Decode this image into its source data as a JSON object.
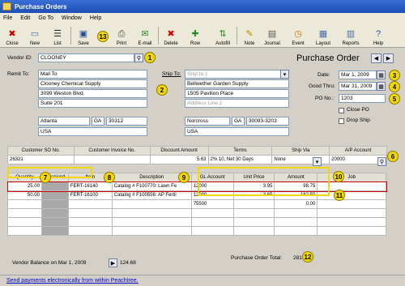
{
  "window": {
    "title": "Purchase Orders"
  },
  "menu": [
    "File",
    "Edit",
    "Go To",
    "Window",
    "Help"
  ],
  "toolbar": {
    "close": "Close",
    "new": "New",
    "list": "List",
    "save": "Save",
    "print": "Print",
    "email": "E-mail",
    "delete": "Delete",
    "row": "Row",
    "autofill": "Autofill",
    "note": "Note",
    "journal": "Journal",
    "event": "Event",
    "layout": "Layout",
    "reports": "Reports",
    "help": "Help"
  },
  "header": {
    "vendor_id_label": "Vendor ID:",
    "vendor_id": "CLOONEY",
    "form_title": "Purchase Order"
  },
  "remit": {
    "label": "Remit To:",
    "select": "Mail To",
    "lines": [
      "Clooney Chemical Supply",
      "3099 Weston Blvd.",
      "Suite 201"
    ],
    "city": "Atlanta",
    "state": "GA",
    "zip": "30312",
    "country": "USA"
  },
  "ship": {
    "label": "Ship To:",
    "select": "Ship to 1",
    "lines": [
      "Bellwether Garden Supply",
      "1505 Pavilion Place",
      "Address Line 2"
    ],
    "city": "Norcross",
    "state": "GA",
    "zip": "30093-3203",
    "country": "USA"
  },
  "dates": {
    "date_label": "Date:",
    "date": "Mar 1, 2009",
    "goodthru_label": "Good Thru:",
    "goodthru": "Mar 31, 2009",
    "po_label": "PO No.:",
    "po": "1203",
    "close_po": "Close PO",
    "drop_ship": "Drop Ship"
  },
  "terms": {
    "headers": [
      "Customer SO No.",
      "Customer Invoice No.",
      "Discount Amount",
      "Terms",
      "Ship Via",
      "A/P Account"
    ],
    "values": [
      "26321",
      "",
      "5.63",
      "2% 10, Net 30 Days",
      "None",
      "20000"
    ]
  },
  "lines": {
    "headers": [
      "Quantity",
      "Received",
      "Item",
      "Description",
      "GL Account",
      "Unit Price",
      "Amount",
      "Job"
    ],
    "rows": [
      [
        "25.00",
        "",
        "FERT-16140",
        "Catalog # F100770: Lawn Fe",
        "12000",
        "3.95",
        "98.75",
        ""
      ],
      [
        "50.00",
        "",
        "FERT-16100",
        "Catalog # F100556: AP Fertil",
        "12000",
        "3.65",
        "182.50",
        ""
      ],
      [
        "",
        "",
        "",
        "",
        "75500",
        "",
        "0.00",
        ""
      ],
      [
        "",
        "",
        "",
        "",
        "",
        "",
        "",
        ""
      ],
      [
        "",
        "",
        "",
        "",
        "",
        "",
        "",
        ""
      ],
      [
        "",
        "",
        "",
        "",
        "",
        "",
        "",
        ""
      ]
    ]
  },
  "footer": {
    "vendor_balance_label": "Vendor Balance on Mar 1, 2009",
    "vendor_balance": "124.68",
    "total_label": "Purchase Order Total:",
    "total": "281.25"
  },
  "status": {
    "link": "Send payments electronically from within Peachtree."
  },
  "callouts": [
    "1",
    "2",
    "3",
    "4",
    "5",
    "6",
    "7",
    "8",
    "9",
    "10",
    "11",
    "12",
    "13"
  ]
}
